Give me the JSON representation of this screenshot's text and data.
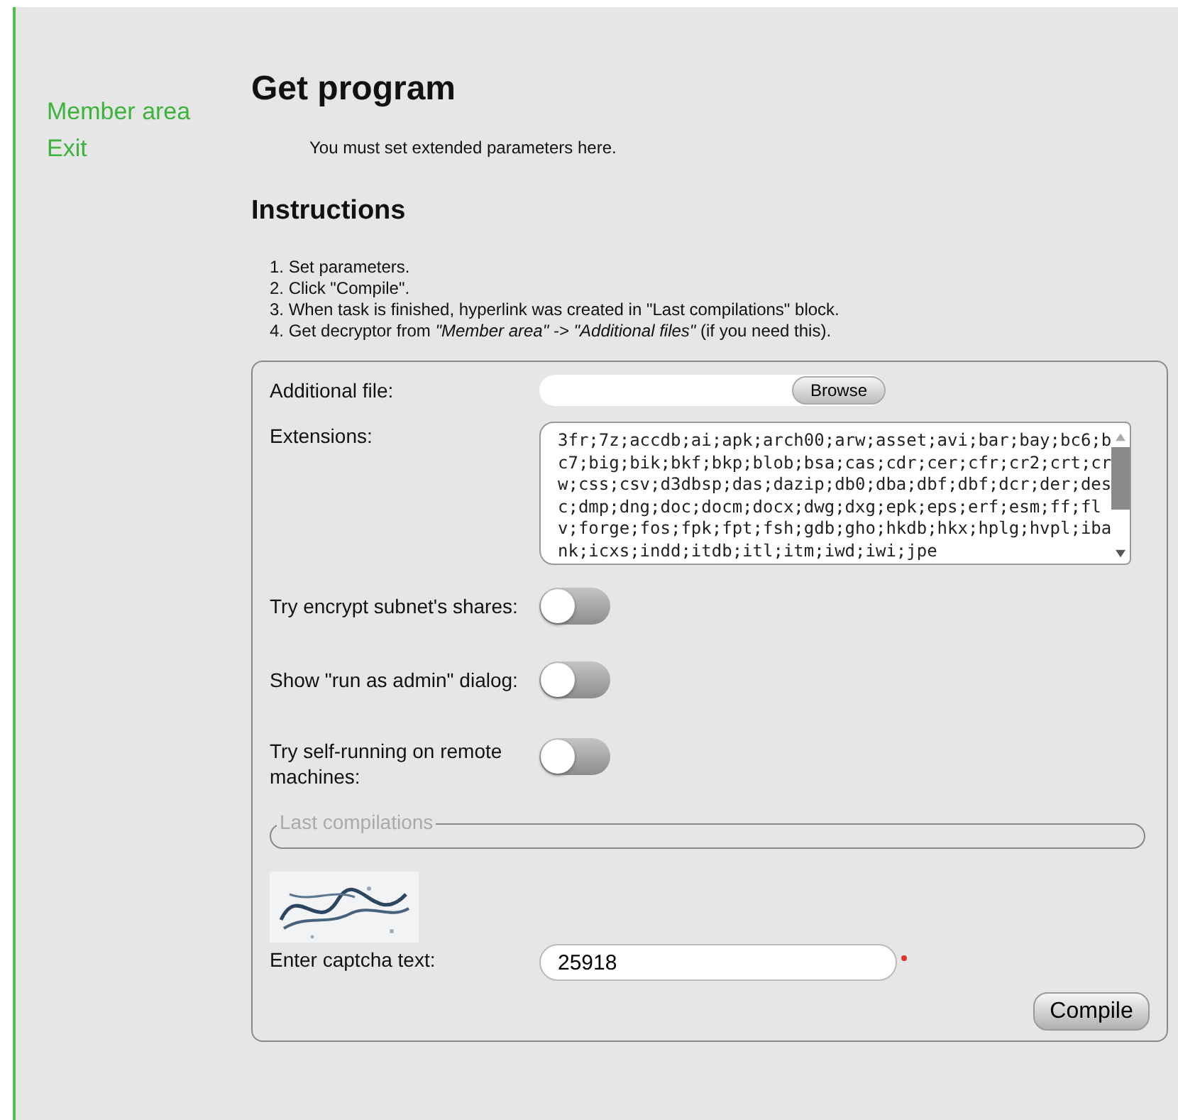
{
  "sidebar": {
    "items": [
      {
        "label": "Member area"
      },
      {
        "label": "Exit"
      }
    ]
  },
  "title": "Get program",
  "intro": "You must set extended parameters here.",
  "instructions": {
    "heading": "Instructions",
    "steps": [
      "1. Set parameters.",
      "2. Click \"Compile\".",
      "3. When task is finished, hyperlink was created in \"Last compilations\" block.",
      "4. Get decryptor from *\"Member area\" -> \"Additional files\"* (if you need this)."
    ]
  },
  "form": {
    "rows": [
      {
        "kind": "file",
        "label": "Additional file:",
        "button": "Browse"
      },
      {
        "kind": "textarea",
        "label": "Extensions:",
        "value": "3fr;7z;accdb;ai;apk;arch00;arw;asset;avi;bar;bay;bc6;bc7;big;bik;bkf;bkp;blob;bsa;cas;cdr;cer;cfr;cr2;crt;crw;css;csv;d3dbsp;das;dazip;db0;dba;dbf;dbf;dcr;der;desc;dmp;dng;doc;docm;docx;dwg;dxg;epk;eps;erf;esm;ff;flv;forge;fos;fpk;fpt;fsh;gdb;gho;hkdb;hkx;hplg;hvpl;ibank;icxs;indd;itdb;itl;itm;iwd;iwi;jpe"
      },
      {
        "kind": "toggle",
        "label": "Try encrypt subnet's shares:",
        "on": false
      },
      {
        "kind": "toggle",
        "label": "Show \"run as admin\" dialog:",
        "on": false
      },
      {
        "kind": "toggle",
        "label": "Try self-running on remote machines:",
        "on": false
      }
    ],
    "last_compilations": {
      "legend": "Last compilations"
    },
    "captcha": {
      "label": "Enter captcha text:",
      "value": "25918",
      "required": true
    },
    "submit": "Compile"
  }
}
